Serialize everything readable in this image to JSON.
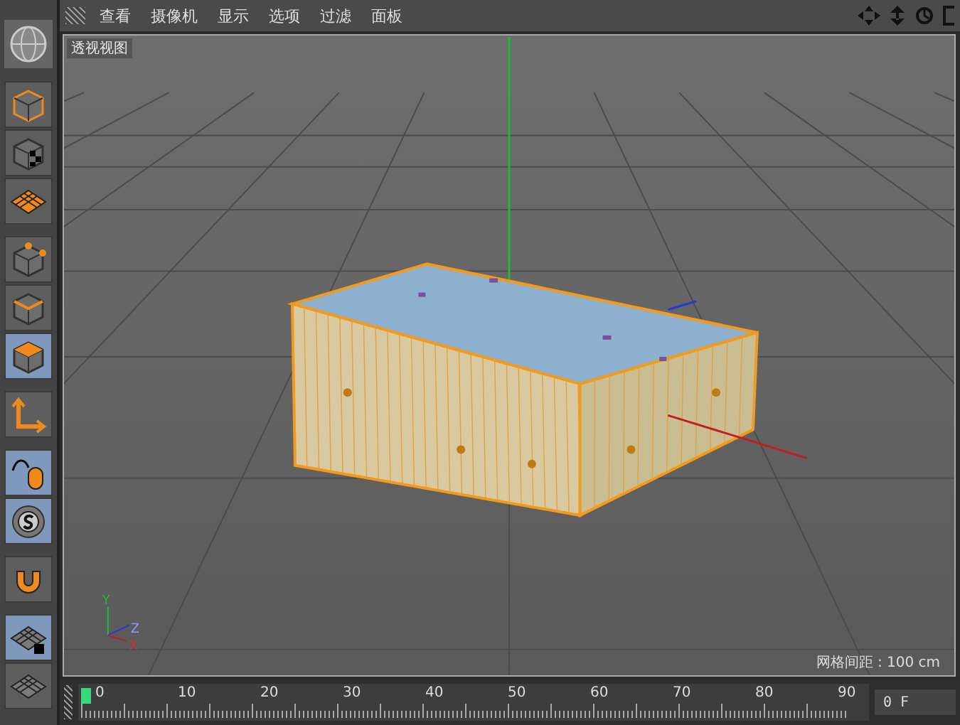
{
  "menu": [
    "查看",
    "摄像机",
    "显示",
    "选项",
    "过滤",
    "面板"
  ],
  "viewport": {
    "label": "透视视图",
    "grid_spacing": "网格间距 : 100 cm",
    "axes": [
      "Y",
      "Z",
      "X"
    ]
  },
  "tools": [
    {
      "selected": false
    },
    {
      "selected": false
    },
    {
      "selected": false
    },
    {
      "selected": false
    },
    {
      "selected": false
    },
    {
      "selected": true
    },
    {
      "selected": false
    },
    {
      "selected": true
    },
    {
      "selected": true
    },
    {
      "selected": false
    },
    {
      "selected": true
    },
    {
      "selected": false
    }
  ],
  "timeline": {
    "ticks": [
      "0",
      "10",
      "20",
      "30",
      "40",
      "50",
      "60",
      "70",
      "80",
      "90"
    ],
    "frame": "0 F"
  }
}
